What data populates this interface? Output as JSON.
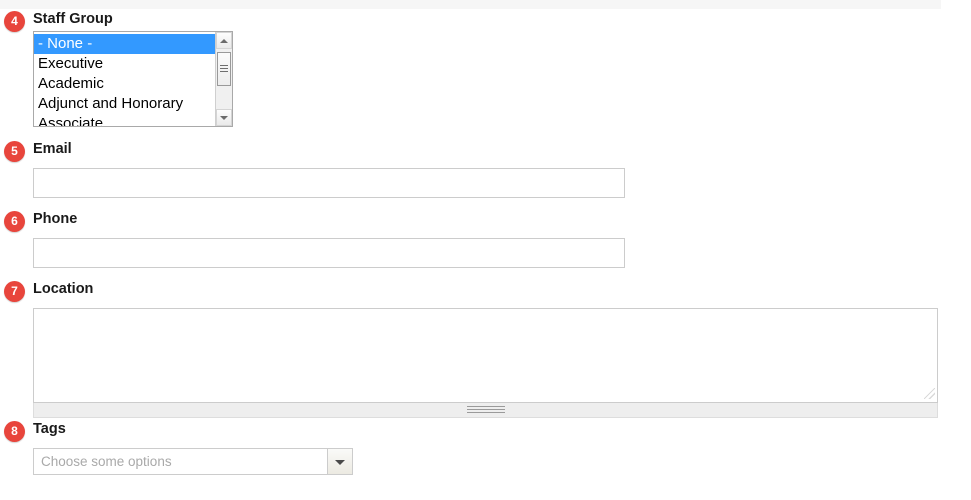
{
  "form": {
    "fields": [
      {
        "number": "4",
        "label": "Staff Group",
        "type": "listbox",
        "options": [
          "- None -",
          "Executive",
          "Academic",
          "Adjunct and Honorary",
          "Associate"
        ],
        "selected": "- None -"
      },
      {
        "number": "5",
        "label": "Email",
        "type": "text",
        "value": "",
        "placeholder": ""
      },
      {
        "number": "6",
        "label": "Phone",
        "type": "text",
        "value": "",
        "placeholder": ""
      },
      {
        "number": "7",
        "label": "Location",
        "type": "textarea",
        "value": "",
        "placeholder": ""
      },
      {
        "number": "8",
        "label": "Tags",
        "type": "chosen",
        "value": "",
        "placeholder": "Choose some options"
      }
    ]
  },
  "colors": {
    "badge": "#e8453c",
    "selection": "#3399ff",
    "border": "#cccccc",
    "top_strip": "#f6f6f6",
    "grabber": "#eeeeee"
  },
  "icons": {
    "scroll_up": "triangle-up",
    "scroll_down": "triangle-down",
    "dropdown": "chevron-down",
    "resize": "resize-grip"
  }
}
